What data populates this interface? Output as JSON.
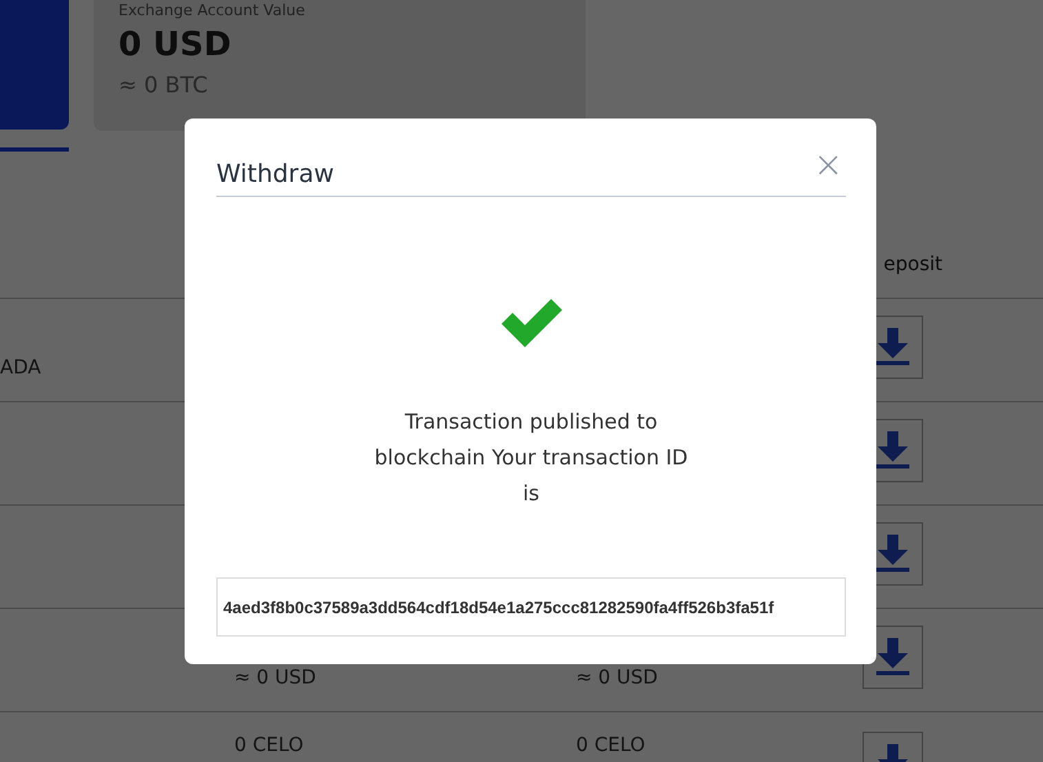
{
  "account_card": {
    "title": "Exchange Account Value",
    "value": "0 USD",
    "btc_value": "≈ 0 BTC"
  },
  "table": {
    "columns": [
      {
        "label": "eposit"
      }
    ],
    "rows": [
      {
        "column_1": "ADA"
      },
      {},
      {},
      {
        "column_2": "≈ 0 USD",
        "column_3": "≈ 0 USD"
      },
      {
        "column_2": "0 CELO",
        "column_3": "0 CELO"
      }
    ]
  },
  "modal": {
    "title": "Withdraw",
    "close": "×",
    "message": "Transaction published to blockchain Your transaction ID is",
    "transaction_id": "4aed3f8b0c37589a3dd564cdf18d54e1a275ccc81282590fa4ff526b3fa51f"
  }
}
